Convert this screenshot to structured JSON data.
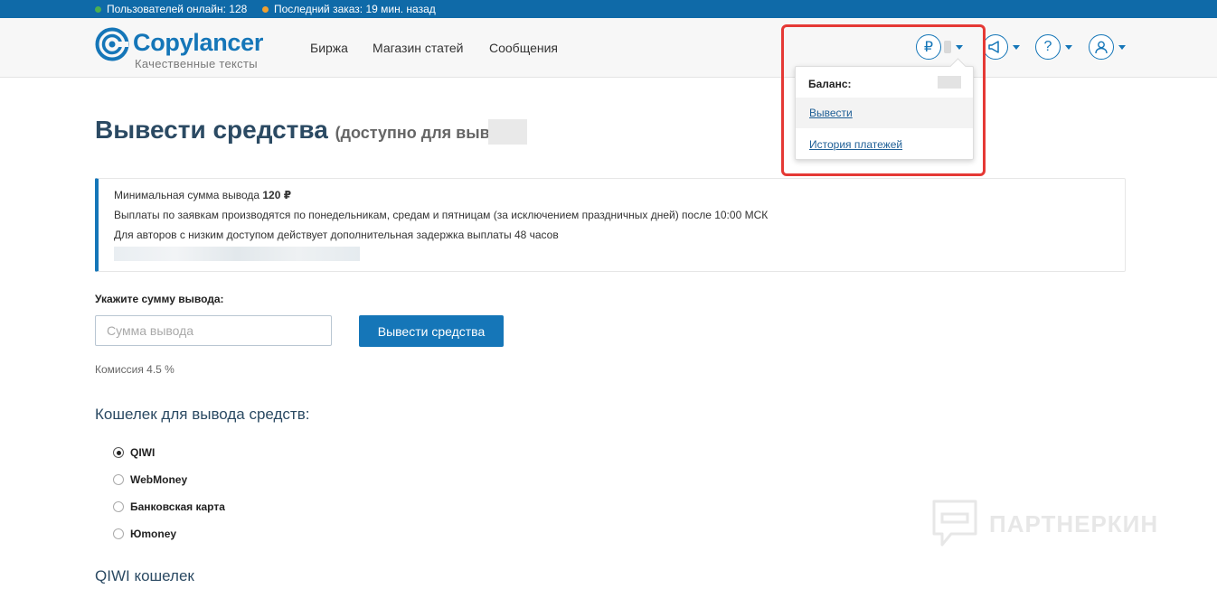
{
  "topbar": {
    "online_label": "Пользователей онлайн: 128",
    "online_color": "#4caf50",
    "last_order_label": "Последний заказ: 19 мин. назад",
    "last_order_color": "#f0a030"
  },
  "header": {
    "logo_text": "Copylancer",
    "logo_tagline": "Качественные тексты",
    "nav": [
      "Биржа",
      "Магазин статей",
      "Сообщения"
    ],
    "icons": [
      "ruble-icon",
      "megaphone-icon",
      "help-icon",
      "user-icon"
    ]
  },
  "dropdown": {
    "balance_label": "Баланс:",
    "withdraw_link": "Вывести",
    "history_link": "История платежей"
  },
  "main": {
    "title": "Вывести средства",
    "title_sub": "(доступно для вывода",
    "info": {
      "min_prefix": "Минимальная сумма вывода ",
      "min_amount": "120 ₽",
      "line2": "Выплаты по заявкам производятся по понедельникам, средам и пятницам (за исключением праздничных дней) после 10:00 МСК",
      "line3": "Для авторов с низким доступом действует дополнительная задержка выплаты 48 часов"
    },
    "amount_label": "Укажите сумму вывода:",
    "amount_placeholder": "Сумма вывода",
    "withdraw_button": "Вывести средства",
    "commission": "Комиссия 4.5 %",
    "wallet_title": "Кошелек для вывода средств:",
    "wallets": [
      "QIWI",
      "WebMoney",
      "Банковская карта",
      "Юmoney"
    ],
    "selected_wallet": "QIWI",
    "qiwi_title": "QIWI кошелек"
  },
  "watermark": "ПАРТНЕРКИН",
  "colors": {
    "accent": "#1576b8",
    "highlight": "#e53935"
  }
}
